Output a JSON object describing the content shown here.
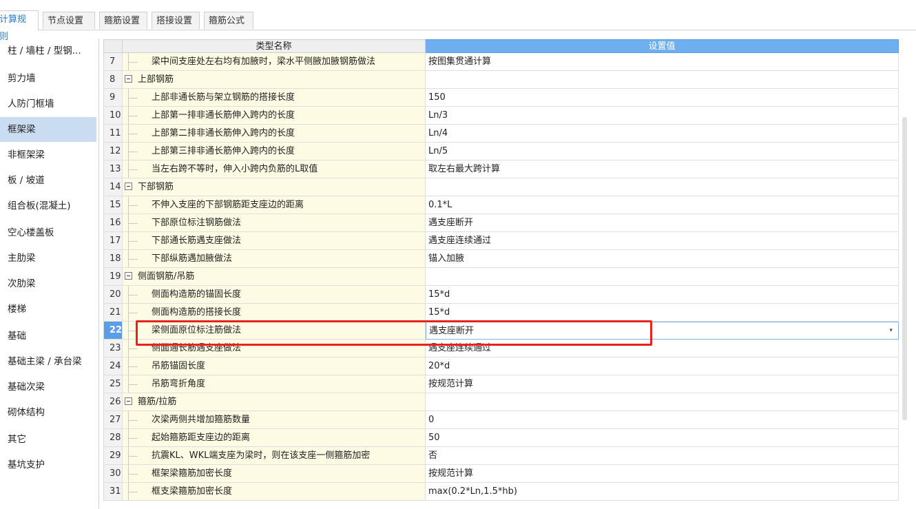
{
  "tabs": [
    {
      "label": "计算规则",
      "active": true
    },
    {
      "label": "节点设置",
      "active": false
    },
    {
      "label": "箍筋设置",
      "active": false
    },
    {
      "label": "搭接设置",
      "active": false
    },
    {
      "label": "箍筋公式",
      "active": false
    }
  ],
  "sidebar": {
    "items": [
      {
        "label": "柱 / 墙柱 / 型钢..."
      },
      {
        "label": "剪力墙"
      },
      {
        "label": "人防门框墙"
      },
      {
        "label": "框架梁",
        "active": true
      },
      {
        "label": "非框架梁"
      },
      {
        "label": "板 / 坡道"
      },
      {
        "label": "组合板(混凝土)"
      },
      {
        "label": "空心楼盖板"
      },
      {
        "label": "主肋梁"
      },
      {
        "label": "次肋梁"
      },
      {
        "label": "楼梯"
      },
      {
        "label": "基础"
      },
      {
        "label": "基础主梁 / 承台梁"
      },
      {
        "label": "基础次梁"
      },
      {
        "label": "砌体结构"
      },
      {
        "label": "其它"
      },
      {
        "label": "基坑支护"
      }
    ]
  },
  "grid": {
    "header_name": "类型名称",
    "header_value": "设置值",
    "rows": [
      {
        "num": "7",
        "name": "梁中间支座处左右均有加腋时，梁水平侧腋加腋钢筋做法",
        "value": "按图集贯通计算"
      },
      {
        "num": "8",
        "name": "上部钢筋",
        "value": "",
        "group": true
      },
      {
        "num": "9",
        "name": "上部非通长筋与架立钢筋的搭接长度",
        "value": "150"
      },
      {
        "num": "10",
        "name": "上部第一排非通长筋伸入跨内的长度",
        "value": "Ln/3"
      },
      {
        "num": "11",
        "name": "上部第二排非通长筋伸入跨内的长度",
        "value": "Ln/4"
      },
      {
        "num": "12",
        "name": "上部第三排非通长筋伸入跨内的长度",
        "value": "Ln/5"
      },
      {
        "num": "13",
        "name": "当左右跨不等时，伸入小跨内负筋的L取值",
        "value": "取左右最大跨计算"
      },
      {
        "num": "14",
        "name": "下部钢筋",
        "value": "",
        "group": true
      },
      {
        "num": "15",
        "name": "不伸入支座的下部钢筋距支座边的距离",
        "value": "0.1*L"
      },
      {
        "num": "16",
        "name": "下部原位标注钢筋做法",
        "value": "遇支座断开"
      },
      {
        "num": "17",
        "name": "下部通长筋遇支座做法",
        "value": "遇支座连续通过"
      },
      {
        "num": "18",
        "name": "下部纵筋遇加腋做法",
        "value": "锚入加腋"
      },
      {
        "num": "19",
        "name": "侧面钢筋/吊筋",
        "value": "",
        "group": true
      },
      {
        "num": "20",
        "name": "侧面构造筋的锚固长度",
        "value": "15*d"
      },
      {
        "num": "21",
        "name": "侧面构造筋的搭接长度",
        "value": "15*d"
      },
      {
        "num": "22",
        "name": "梁侧面原位标注筋做法",
        "value": "遇支座断开",
        "selected": true
      },
      {
        "num": "23",
        "name": "侧面通长筋遇支座做法",
        "value": "遇支座连续通过"
      },
      {
        "num": "24",
        "name": "吊筋锚固长度",
        "value": "20*d"
      },
      {
        "num": "25",
        "name": "吊筋弯折角度",
        "value": "按规范计算"
      },
      {
        "num": "26",
        "name": "箍筋/拉筋",
        "value": "",
        "group": true
      },
      {
        "num": "27",
        "name": "次梁两侧共增加箍筋数量",
        "value": "0"
      },
      {
        "num": "28",
        "name": "起始箍筋距支座边的距离",
        "value": "50"
      },
      {
        "num": "29",
        "name": "抗震KL、WKL端支座为梁时，则在该支座一侧箍筋加密",
        "value": "否"
      },
      {
        "num": "30",
        "name": "框架梁箍筋加密长度",
        "value": "按规范计算"
      },
      {
        "num": "31",
        "name": "框支梁箍筋加密长度",
        "value": "max(0.2*Ln,1.5*hb)"
      }
    ]
  },
  "icons": {
    "dropdown": "chevron-down-icon",
    "collapse": "collapse-minus-icon"
  },
  "colors": {
    "accent": "#2b79c8",
    "selected_row": "#5a9ee8",
    "highlight": "#e8231e",
    "name_col_bg": "#fdfbe3"
  }
}
